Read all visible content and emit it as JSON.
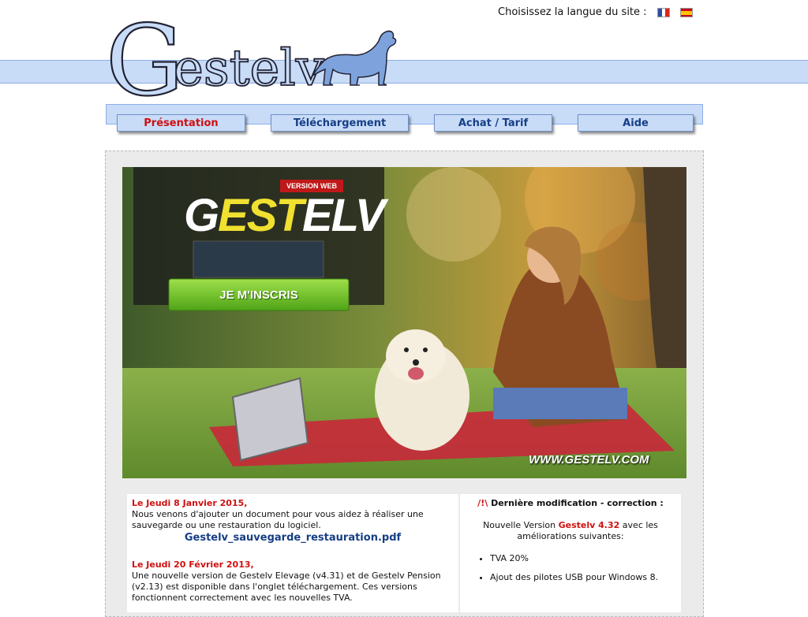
{
  "header": {
    "logo_text": "Gestelv",
    "language_prompt": "Choisissez la langue du site :",
    "flags": [
      "french-flag",
      "spanish-flag"
    ]
  },
  "nav": {
    "items": [
      {
        "label": "Présentation",
        "active": true
      },
      {
        "label": "Téléchargement",
        "active": false
      },
      {
        "label": "Achat / Tarif",
        "active": false
      },
      {
        "label": "Aide",
        "active": false
      }
    ]
  },
  "banner": {
    "version_tag": "VERSION WEB",
    "product_logo": "GESTELV",
    "signup_button": "JE M'INSCRIS",
    "website": "WWW.GESTELV.COM"
  },
  "news": {
    "item1_date": "Le Jeudi 8 Janvier 2015,",
    "item1_text": "Nous venons d'ajouter un document pour vous aidez à réaliser une sauvegarde ou une restauration du logiciel.",
    "item1_link": "Gestelv_sauvegarde_restauration.pdf",
    "item2_date": "Le Jeudi 20 Février 2013,",
    "item2_text": "Une nouvelle version de Gestelv Elevage (v4.31) et de Gestelv Pension (v2.13) est disponible dans l'onglet téléchargement. Ces versions fonctionnent correctement avec les nouvelles TVA."
  },
  "update": {
    "warning": "/!\\",
    "title": "Dernière modification - correction :",
    "intro_prefix": "Nouvelle Version",
    "version": "Gestelv 4.32",
    "intro_suffix": "avec les améliorations suivantes:",
    "items": [
      "TVA 20%",
      "Ajout des pilotes USB pour Windows 8."
    ]
  },
  "colors": {
    "accent_red": "#d01010",
    "nav_blue": "#163e86",
    "band_blue": "#c8dcf8",
    "signup_green": "#6cc21e"
  }
}
